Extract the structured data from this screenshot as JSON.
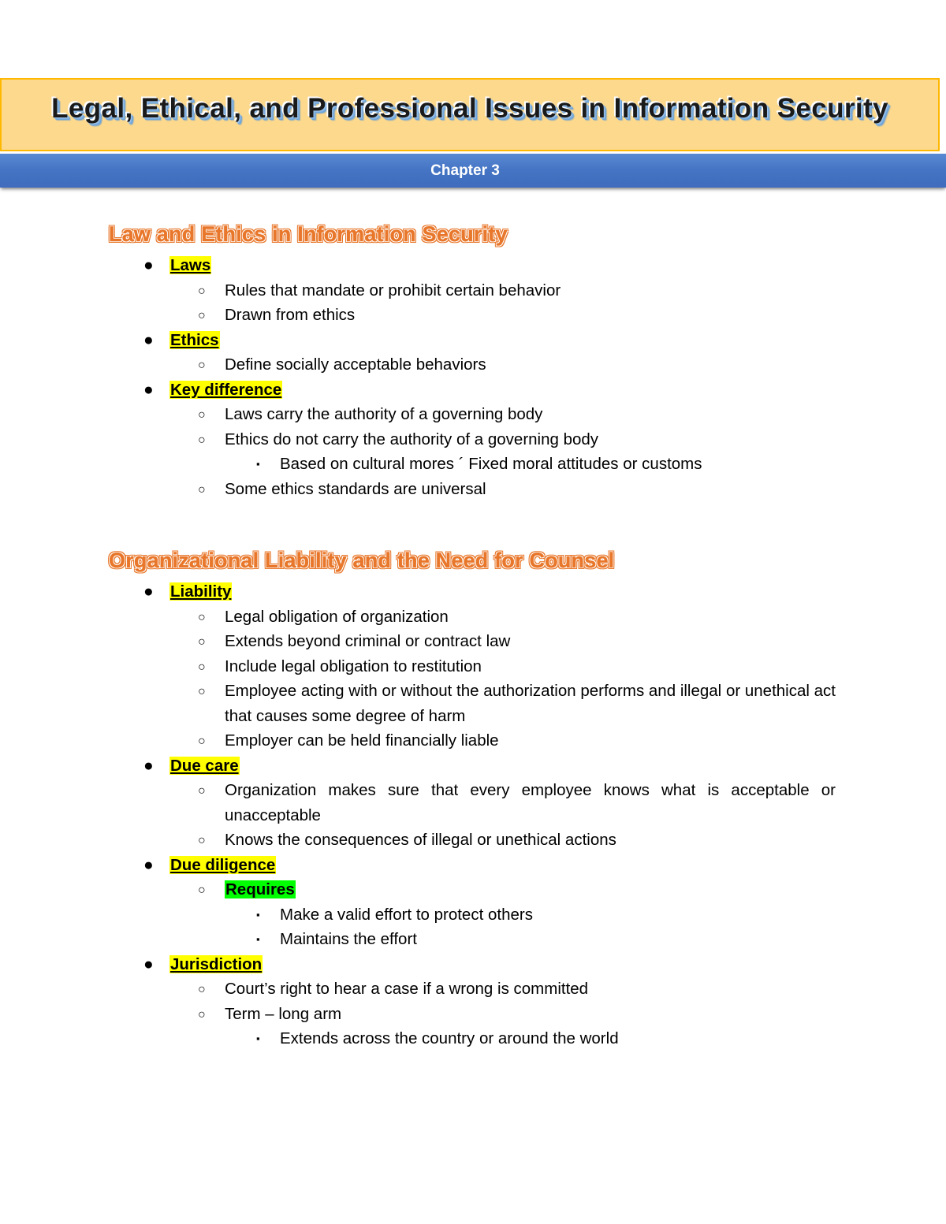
{
  "header": {
    "title": "Legal, Ethical, and Professional Issues in Information Security",
    "chapter": "Chapter 3",
    "banner_bg": "#FDD98E",
    "banner_border": "#FFB800",
    "chapter_bar_bg": "#4575C4"
  },
  "colors": {
    "heading_orange": "#E8772B",
    "highlight_yellow": "#FFFF00",
    "highlight_green": "#00FF00"
  },
  "sections": [
    {
      "heading": "Law and Ethics in Information Security",
      "items": [
        {
          "label": "Laws",
          "children": [
            {
              "text": "Rules that mandate or prohibit certain behavior"
            },
            {
              "text": "Drawn from ethics"
            }
          ]
        },
        {
          "label": "Ethics",
          "children": [
            {
              "text": "Define socially acceptable behaviors"
            }
          ]
        },
        {
          "label": "Key difference",
          "children": [
            {
              "text": "Laws carry the authority of a governing body"
            },
            {
              "text": "Ethics do not carry the authority of a governing body",
              "children": [
                {
                  "text": "Based on cultural mores ´ Fixed moral attitudes or customs"
                }
              ]
            },
            {
              "text": "Some ethics standards are universal"
            }
          ]
        }
      ]
    },
    {
      "heading": "Organizational Liability and the Need for Counsel",
      "items": [
        {
          "label": "Liability",
          "children": [
            {
              "text": "Legal obligation of organization"
            },
            {
              "text": "Extends beyond criminal or contract law"
            },
            {
              "text": "Include legal obligation to restitution"
            },
            {
              "text": "Employee acting with or without the authorization performs and illegal or unethical act that causes some degree of harm",
              "justify": true
            },
            {
              "text": "Employer can be held financially liable"
            }
          ]
        },
        {
          "label": "Due care",
          "children": [
            {
              "text": "Organization makes sure that every employee knows what is acceptable or unacceptable",
              "justify": true
            },
            {
              "text": "Knows the consequences of illegal or unethical actions"
            }
          ]
        },
        {
          "label": "Due diligence",
          "children": [
            {
              "text": "Requires",
              "highlight": "green",
              "children": [
                {
                  "text": "Make a valid effort to protect others"
                },
                {
                  "text": "Maintains the effort"
                }
              ]
            }
          ]
        },
        {
          "label": "Jurisdiction",
          "children": [
            {
              "text": "Court’s right to hear a case if a wrong is committed"
            },
            {
              "text": "Term – long arm",
              "children": [
                {
                  "text": "Extends across the country or around the world"
                }
              ]
            }
          ]
        }
      ]
    }
  ],
  "markers": {
    "level1": "●",
    "level2": "○",
    "level3": "▪"
  }
}
